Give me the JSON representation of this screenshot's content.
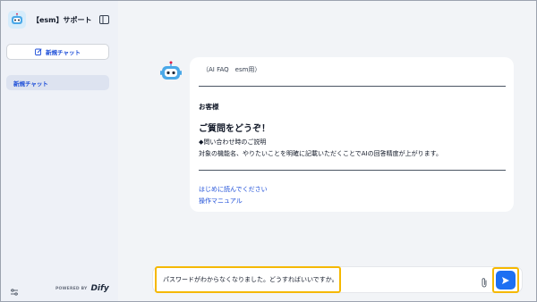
{
  "sidebar": {
    "app_title": "【esm】サポートFA...",
    "new_chat_label": "新規チャット",
    "conversations": [
      {
        "label": "新規チャット"
      }
    ],
    "powered_by": "POWERED BY",
    "brand": "Dify"
  },
  "chat": {
    "message": {
      "title": "（AI FAQ　esm用）",
      "greeting": "お客様",
      "heading": "ご質問をどうぞ！",
      "line1": "◆問い合わせ時のご説明",
      "line2": "対象の機能名、やりたいことを明確に記載いただくことでAIの回答精度が上がります。",
      "links": [
        "はじめに読んでください",
        "操作マニュアル"
      ]
    },
    "input": {
      "value": "パスワードがわからなくなりました。どうすればいいですか。"
    }
  },
  "colors": {
    "accent": "#1d6ff2",
    "highlight": "#f5b800",
    "sidebar_bg": "#eef1f7",
    "main_bg": "#f2f4f7"
  }
}
